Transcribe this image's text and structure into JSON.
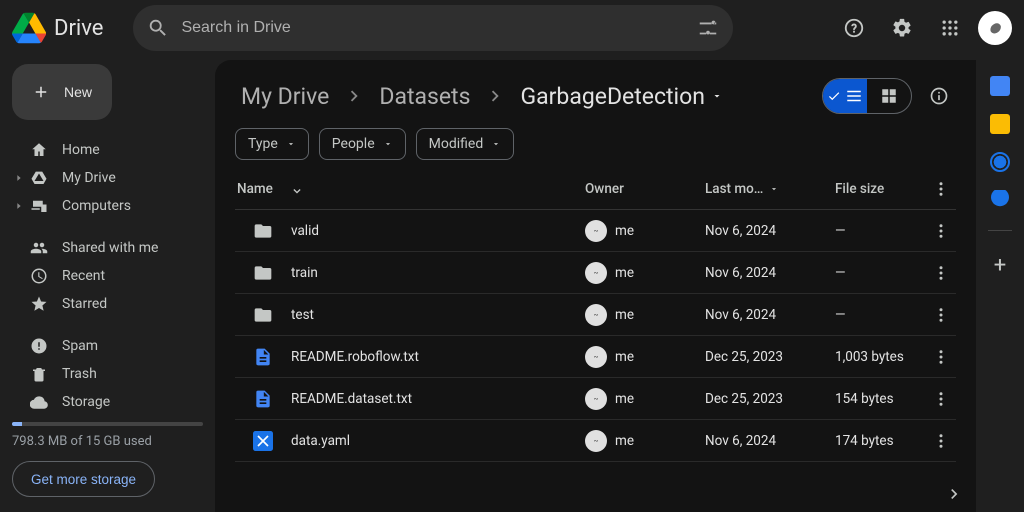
{
  "app": {
    "title": "Drive"
  },
  "search": {
    "placeholder": "Search in Drive"
  },
  "sidebar": {
    "new_label": "New",
    "items": [
      {
        "label": "Home",
        "icon": "home"
      },
      {
        "label": "My Drive",
        "icon": "drive",
        "expandable": true
      },
      {
        "label": "Computers",
        "icon": "devices",
        "expandable": true
      },
      {
        "label": "Shared with me",
        "icon": "people"
      },
      {
        "label": "Recent",
        "icon": "clock"
      },
      {
        "label": "Starred",
        "icon": "star"
      },
      {
        "label": "Spam",
        "icon": "spam"
      },
      {
        "label": "Trash",
        "icon": "trash"
      },
      {
        "label": "Storage",
        "icon": "cloud"
      }
    ],
    "storage_used_text": "798.3 MB of 15 GB used",
    "storage_percent": 5.3,
    "storage_button": "Get more storage"
  },
  "breadcrumbs": [
    "My Drive",
    "Datasets",
    "GarbageDetection"
  ],
  "filters": {
    "type": "Type",
    "people": "People",
    "modified": "Modified"
  },
  "columns": {
    "name": "Name",
    "owner": "Owner",
    "last_modified": "Last mo…",
    "file_size": "File size"
  },
  "owner_label": "me",
  "files": [
    {
      "name": "valid",
      "type": "folder",
      "owner": "me",
      "modified": "Nov 6, 2024",
      "size": "—"
    },
    {
      "name": "train",
      "type": "folder",
      "owner": "me",
      "modified": "Nov 6, 2024",
      "size": "—"
    },
    {
      "name": "test",
      "type": "folder",
      "owner": "me",
      "modified": "Nov 6, 2024",
      "size": "—"
    },
    {
      "name": "README.roboflow.txt",
      "type": "doc",
      "owner": "me",
      "modified": "Dec 25, 2023",
      "size": "1,003 bytes"
    },
    {
      "name": "README.dataset.txt",
      "type": "doc",
      "owner": "me",
      "modified": "Dec 25, 2023",
      "size": "154 bytes"
    },
    {
      "name": "data.yaml",
      "type": "yaml",
      "owner": "me",
      "modified": "Nov 6, 2024",
      "size": "174 bytes"
    }
  ]
}
